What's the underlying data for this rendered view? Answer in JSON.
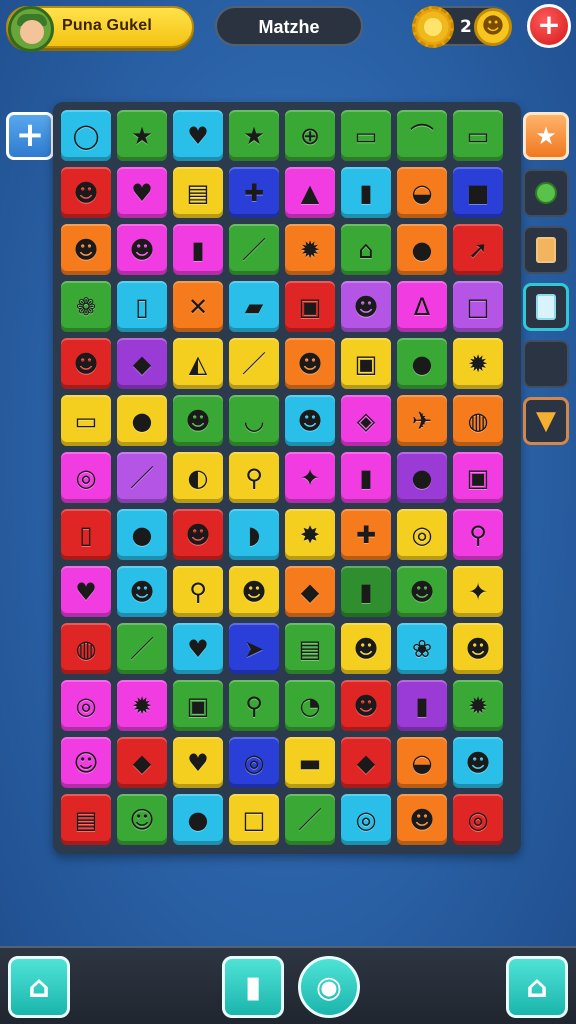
{
  "header": {
    "player_name": "Puna Gukel",
    "game_title": "Matzhe",
    "coin_count": "2",
    "add_button_symbol": "+"
  },
  "side_left": {
    "add_symbol": "+"
  },
  "side_right": {
    "buttons": [
      {
        "icon": "star-icon",
        "glyph": "★"
      },
      {
        "icon": "green-bulb-icon"
      },
      {
        "icon": "orange-card-icon"
      },
      {
        "icon": "blue-card-icon"
      },
      {
        "icon": "empty-slot"
      },
      {
        "icon": "carrot-icon",
        "glyph": "▼"
      }
    ]
  },
  "board": {
    "rows": 13,
    "cols": 8,
    "tiles": [
      [
        "#29bfe8",
        "◯"
      ],
      [
        "#3aa835",
        "★"
      ],
      [
        "#29bfe8",
        "♥"
      ],
      [
        "#3aa835",
        "★"
      ],
      [
        "#3aa835",
        "⊕"
      ],
      [
        "#3aa835",
        "▭"
      ],
      [
        "#3aa835",
        "⌒"
      ],
      [
        "#3aa835",
        "▭"
      ],
      [
        "#e02525",
        "☻"
      ],
      [
        "#f03ce0",
        "♥"
      ],
      [
        "#f5cf1f",
        "▤"
      ],
      [
        "#2a3fd8",
        "✚"
      ],
      [
        "#f03ce0",
        "▲"
      ],
      [
        "#29bfe8",
        "▮"
      ],
      [
        "#f57b1d",
        "◒"
      ],
      [
        "#2a3fd8",
        "■"
      ],
      [
        "#f57b1d",
        "☻"
      ],
      [
        "#f03ce0",
        "☻"
      ],
      [
        "#f03ce0",
        "▮"
      ],
      [
        "#3aa835",
        "／"
      ],
      [
        "#f57b1d",
        "✹"
      ],
      [
        "#3aa835",
        "⌂"
      ],
      [
        "#f57b1d",
        "●"
      ],
      [
        "#e02525",
        "➚"
      ],
      [
        "#3aa835",
        "❁"
      ],
      [
        "#29bfe8",
        "▯"
      ],
      [
        "#f57b1d",
        "✕"
      ],
      [
        "#29bfe8",
        "▰"
      ],
      [
        "#e02525",
        "▣"
      ],
      [
        "#b455e6",
        "☻"
      ],
      [
        "#f03ce0",
        "Δ"
      ],
      [
        "#b455e6",
        "□"
      ],
      [
        "#e02525",
        "☻"
      ],
      [
        "#9b3bd6",
        "◆"
      ],
      [
        "#f5cf1f",
        "◭"
      ],
      [
        "#f5cf1f",
        "／"
      ],
      [
        "#f57b1d",
        "☻"
      ],
      [
        "#f5cf1f",
        "▣"
      ],
      [
        "#3aa835",
        "●"
      ],
      [
        "#f5cf1f",
        "✹"
      ],
      [
        "#f5cf1f",
        "▭"
      ],
      [
        "#f5cf1f",
        "●"
      ],
      [
        "#3aa835",
        "☻"
      ],
      [
        "#3aa835",
        "◡"
      ],
      [
        "#29bfe8",
        "☻"
      ],
      [
        "#f03ce0",
        "◈"
      ],
      [
        "#f57b1d",
        "✈"
      ],
      [
        "#f57b1d",
        "◍"
      ],
      [
        "#f03ce0",
        "◎"
      ],
      [
        "#b455e6",
        "／"
      ],
      [
        "#f5cf1f",
        "◐"
      ],
      [
        "#f5cf1f",
        "⚲"
      ],
      [
        "#f03ce0",
        "✦"
      ],
      [
        "#f03ce0",
        "▮"
      ],
      [
        "#9b3bd6",
        "●"
      ],
      [
        "#f03ce0",
        "▣"
      ],
      [
        "#e02525",
        "▯"
      ],
      [
        "#29bfe8",
        "●"
      ],
      [
        "#e02525",
        "☻"
      ],
      [
        "#29bfe8",
        "◗"
      ],
      [
        "#f5cf1f",
        "✸"
      ],
      [
        "#f57b1d",
        "✚"
      ],
      [
        "#f5cf1f",
        "◎"
      ],
      [
        "#f03ce0",
        "⚲"
      ],
      [
        "#f03ce0",
        "♥"
      ],
      [
        "#29bfe8",
        "☻"
      ],
      [
        "#f5cf1f",
        "⚲"
      ],
      [
        "#f5cf1f",
        "☻"
      ],
      [
        "#f57b1d",
        "◆"
      ],
      [
        "#2f8f2f",
        "▮"
      ],
      [
        "#3aa835",
        "☻"
      ],
      [
        "#f5cf1f",
        "✦"
      ],
      [
        "#e02525",
        "◍"
      ],
      [
        "#3aa835",
        "／"
      ],
      [
        "#29bfe8",
        "♥"
      ],
      [
        "#2a3fd8",
        "➤"
      ],
      [
        "#3aa835",
        "▤"
      ],
      [
        "#f5cf1f",
        "☻"
      ],
      [
        "#29bfe8",
        "❀"
      ],
      [
        "#f5cf1f",
        "☻"
      ],
      [
        "#f03ce0",
        "◎"
      ],
      [
        "#f03ce0",
        "✹"
      ],
      [
        "#3aa835",
        "▣"
      ],
      [
        "#3aa835",
        "⚲"
      ],
      [
        "#3aa835",
        "◔"
      ],
      [
        "#e02525",
        "☻"
      ],
      [
        "#9b3bd6",
        "▮"
      ],
      [
        "#3aa835",
        "✹"
      ],
      [
        "#f03ce0",
        "☺"
      ],
      [
        "#e02525",
        "◆"
      ],
      [
        "#f5cf1f",
        "♥"
      ],
      [
        "#2a3fd8",
        "◎"
      ],
      [
        "#f5cf1f",
        "▬"
      ],
      [
        "#e02525",
        "◆"
      ],
      [
        "#f57b1d",
        "◒"
      ],
      [
        "#29bfe8",
        "☻"
      ],
      [
        "#e02525",
        "▤"
      ],
      [
        "#3aa835",
        "☺"
      ],
      [
        "#29bfe8",
        "●"
      ],
      [
        "#f5cf1f",
        "□"
      ],
      [
        "#3aa835",
        "／"
      ],
      [
        "#29bfe8",
        "◎"
      ],
      [
        "#f57b1d",
        "☻"
      ],
      [
        "#e02525",
        "◎"
      ]
    ]
  },
  "bottom_bar": {
    "buttons": [
      {
        "icon": "home-icon",
        "glyph": "⌂"
      },
      {
        "icon": "pause-icon",
        "glyph": "▮"
      },
      {
        "icon": "profile-icon",
        "glyph": "◉"
      },
      {
        "icon": "shop-icon",
        "glyph": "⌂"
      }
    ]
  },
  "colors": {
    "background": "#2a61a6",
    "board": "#2c3a4d",
    "accent_yellow": "#f4c313",
    "accent_teal": "#1bb5ad",
    "accent_red": "#d41818"
  }
}
